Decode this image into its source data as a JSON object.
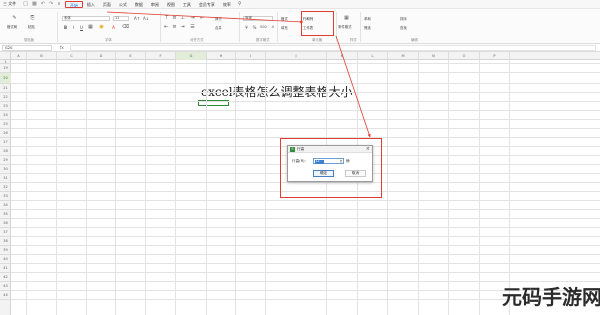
{
  "menubar": {
    "file_label": "三 文件",
    "tabs": [
      {
        "label": "开始",
        "active": true
      },
      {
        "label": "插入",
        "active": false
      },
      {
        "label": "页面",
        "active": false
      },
      {
        "label": "公式",
        "active": false
      },
      {
        "label": "数据",
        "active": false
      },
      {
        "label": "审阅",
        "active": false
      },
      {
        "label": "视图",
        "active": false
      },
      {
        "label": "工具",
        "active": false
      },
      {
        "label": "会员专享",
        "active": false
      },
      {
        "label": "效率",
        "active": false
      }
    ]
  },
  "ribbon": {
    "format_painter": "格式刷",
    "paste": "粘贴",
    "clipboard_group": "剪贴板",
    "font_name": "宋体",
    "font_size": "11",
    "font_group": "字体",
    "wrap": "换行",
    "merge": "合并",
    "align_group": "对齐方式",
    "number_format": "常规",
    "number_group": "数字格式",
    "styles": "格式",
    "fill": "填充",
    "rows_cols": "行和列",
    "worksheet": "工作表",
    "cells_group": "单元格",
    "cond_format": "条件格式",
    "styles_group": "样式",
    "sum": "求和",
    "filter": "筛选",
    "sort": "排序",
    "find": "查找",
    "edit_group": "编辑"
  },
  "formula": {
    "name_box": "G20",
    "fx": "fx"
  },
  "columns": [
    "A",
    "B",
    "C",
    "D",
    "E",
    "F",
    "G",
    "H",
    "I",
    "J",
    "K",
    "L",
    "M",
    "N",
    "O",
    "P"
  ],
  "rows": [
    "1",
    "19",
    "20",
    "21",
    "22",
    "23",
    "24",
    "25",
    "26",
    "27",
    "28",
    "29",
    "30",
    "31",
    "32",
    "33",
    "34",
    "35",
    "36",
    "37",
    "38",
    "39",
    "40",
    "41",
    "42",
    "43",
    "44"
  ],
  "cell_text": "excel表格怎么调整表格大小",
  "dialog": {
    "title": "行高",
    "label": "行高(R):",
    "value": "12",
    "unit": "磅",
    "ok": "确定",
    "cancel": "取消"
  },
  "watermark": "元码手游网",
  "colors": {
    "accent_red": "#e23d2f",
    "selection_green": "#2f8a3a",
    "active_tab_blue": "#1a6dd6"
  }
}
